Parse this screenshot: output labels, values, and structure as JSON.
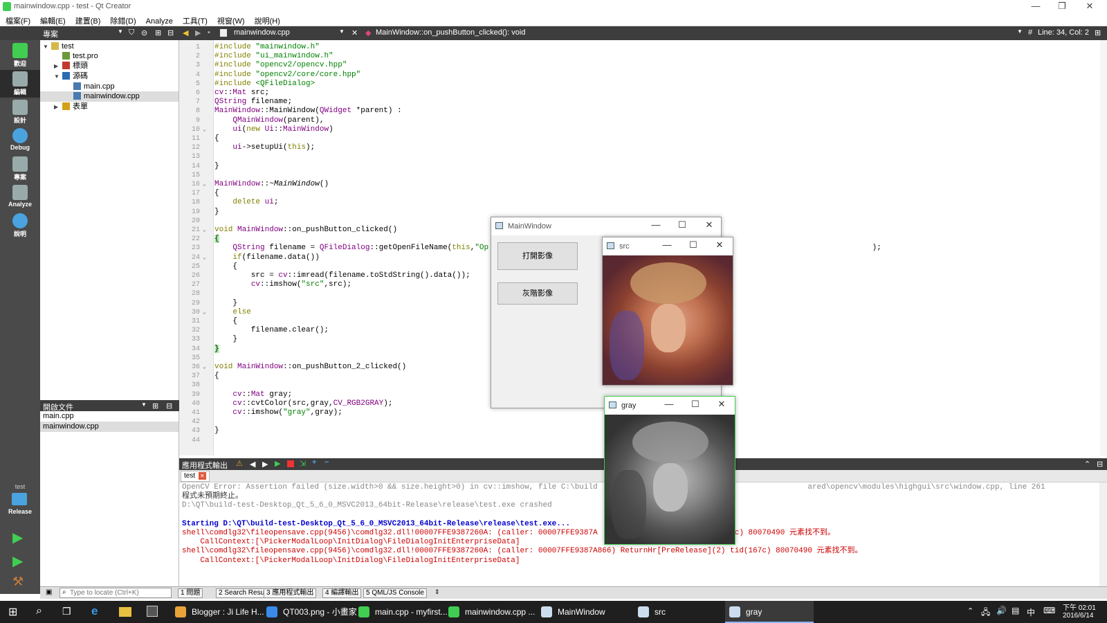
{
  "window": {
    "title": "mainwindow.cpp - test - Qt Creator"
  },
  "menu": [
    "檔案(F)",
    "編輯(E)",
    "建置(B)",
    "除錯(D)",
    "Analyze",
    "工具(T)",
    "視窗(W)",
    "說明(H)"
  ],
  "toolbar": {
    "project_label": "專案",
    "file_name": "mainwindow.cpp",
    "function_name": "MainWindow::on_pushButton_clicked(): void",
    "cursor_pos": "Line: 34, Col: 2"
  },
  "modes": [
    {
      "label": "歡迎",
      "icon": "qt-logo-icon"
    },
    {
      "label": "編輯",
      "icon": "edit-icon"
    },
    {
      "label": "設計",
      "icon": "design-icon"
    },
    {
      "label": "Debug",
      "icon": "debug-icon"
    },
    {
      "label": "專案",
      "icon": "projects-icon"
    },
    {
      "label": "Analyze",
      "icon": "analyze-icon"
    },
    {
      "label": "說明",
      "icon": "help-icon"
    }
  ],
  "kit": {
    "project": "test",
    "config": "Release"
  },
  "project_tree": [
    {
      "label": "test",
      "level": 0,
      "arrow": "▼",
      "icon_color": "#d4b84a"
    },
    {
      "label": "test.pro",
      "level": 1,
      "arrow": "",
      "icon_color": "#6a9a3a"
    },
    {
      "label": "標頭",
      "level": 1,
      "arrow": "▶",
      "icon_color": "#c0392b"
    },
    {
      "label": "源碼",
      "level": 1,
      "arrow": "▼",
      "icon_color": "#2b6cb0"
    },
    {
      "label": "main.cpp",
      "level": 2,
      "arrow": "",
      "icon_color": "#4a7ab0"
    },
    {
      "label": "mainwindow.cpp",
      "level": 2,
      "arrow": "",
      "icon_color": "#4a7ab0",
      "selected": true
    },
    {
      "label": "表單",
      "level": 1,
      "arrow": "▶",
      "icon_color": "#d4a017"
    }
  ],
  "open_docs": {
    "title": "開啟文件",
    "items": [
      {
        "label": "main.cpp"
      },
      {
        "label": "mainwindow.cpp",
        "selected": true
      }
    ]
  },
  "code_lines": [
    {
      "n": "1",
      "fold": "",
      "html": "<span class='kw'>#include</span> <span class='str'>\"mainwindow.h\"</span>"
    },
    {
      "n": "2",
      "fold": "",
      "html": "<span class='kw'>#include</span> <span class='str'>\"ui_mainwindow.h\"</span>"
    },
    {
      "n": "3",
      "fold": "",
      "html": "<span class='kw'>#include</span> <span class='str'>\"opencv2/opencv.hpp\"</span>"
    },
    {
      "n": "4",
      "fold": "",
      "html": "<span class='kw'>#include</span> <span class='str'>\"opencv2/core/core.hpp\"</span>"
    },
    {
      "n": "5",
      "fold": "",
      "html": "<span class='kw'>#include</span> <span class='str'>&lt;QFileDialog&gt;</span>"
    },
    {
      "n": "6",
      "fold": "",
      "html": "<span class='typ'>cv</span>::<span class='typ'>Mat</span> src;"
    },
    {
      "n": "7",
      "fold": "",
      "html": "<span class='typ'>QString</span> filename;"
    },
    {
      "n": "8",
      "fold": "",
      "html": "<span class='typ'>MainWindow</span>::MainWindow(<span class='typ'>QWidget</span> *parent) :"
    },
    {
      "n": "9",
      "fold": "",
      "html": "    <span class='typ'>QMainWindow</span>(parent),"
    },
    {
      "n": "10",
      "fold": "⌄",
      "html": "    <span class='typ'>ui</span>(<span class='kw'>new</span> <span class='typ'>Ui</span>::<span class='typ'>MainWindow</span>)"
    },
    {
      "n": "11",
      "fold": "",
      "html": "{"
    },
    {
      "n": "12",
      "fold": "",
      "html": "    <span class='typ'>ui</span>-&gt;setupUi(<span class='kw'>this</span>);"
    },
    {
      "n": "13",
      "fold": "",
      "html": ""
    },
    {
      "n": "14",
      "fold": "",
      "html": "}"
    },
    {
      "n": "15",
      "fold": "",
      "html": ""
    },
    {
      "n": "16",
      "fold": "⌄",
      "html": "<span class='typ'>MainWindow</span>::~<i>MainWindow</i>()"
    },
    {
      "n": "17",
      "fold": "",
      "html": "{"
    },
    {
      "n": "18",
      "fold": "",
      "html": "    <span class='kw'>delete</span> <span class='typ'>ui</span>;"
    },
    {
      "n": "19",
      "fold": "",
      "html": "}"
    },
    {
      "n": "20",
      "fold": "",
      "html": ""
    },
    {
      "n": "21",
      "fold": "⌄",
      "html": "<span class='kw'>void</span> <span class='typ'>MainWindow</span>::on_pushButton_clicked()"
    },
    {
      "n": "22",
      "fold": "",
      "html": "<span style='background:#b4eeb4'>{</span>"
    },
    {
      "n": "23",
      "fold": "",
      "html": "    <span class='typ'>QString</span> filename = <span class='typ'>QFileDialog</span>::getOpenFileName(<span class='kw'>this</span>,<span class='str'>\"Op</span>                                                                                    );"
    },
    {
      "n": "24",
      "fold": "⌄",
      "html": "    <span class='kw'>if</span>(filename.data())"
    },
    {
      "n": "25",
      "fold": "",
      "html": "    {"
    },
    {
      "n": "26",
      "fold": "",
      "html": "        src = <span class='typ'>cv</span>::imread(filename.toStdString().data());"
    },
    {
      "n": "27",
      "fold": "",
      "html": "        <span class='typ'>cv</span>::imshow(<span class='str'>\"src\"</span>,src);"
    },
    {
      "n": "28",
      "fold": "",
      "html": ""
    },
    {
      "n": "29",
      "fold": "",
      "html": "    }"
    },
    {
      "n": "30",
      "fold": "⌄",
      "html": "    <span class='kw'>else</span>"
    },
    {
      "n": "31",
      "fold": "",
      "html": "    {"
    },
    {
      "n": "32",
      "fold": "",
      "html": "        filename.clear();"
    },
    {
      "n": "33",
      "fold": "",
      "html": "    }"
    },
    {
      "n": "34",
      "fold": "",
      "html": "<span style='background:#b4eeb4'>}</span>"
    },
    {
      "n": "35",
      "fold": "",
      "html": ""
    },
    {
      "n": "36",
      "fold": "⌄",
      "html": "<span class='kw'>void</span> <span class='typ'>MainWindow</span>::on_pushButton_2_clicked()"
    },
    {
      "n": "37",
      "fold": "",
      "html": "{"
    },
    {
      "n": "38",
      "fold": "",
      "html": ""
    },
    {
      "n": "39",
      "fold": "",
      "html": "    <span class='typ'>cv</span>::<span class='typ'>Mat</span> gray;"
    },
    {
      "n": "40",
      "fold": "",
      "html": "    <span class='typ'>cv</span>::cvtColor(src,gray,<span class='typ'>CV_RGB2GRAY</span>);"
    },
    {
      "n": "41",
      "fold": "",
      "html": "    <span class='typ'>cv</span>::imshow(<span class='str'>\"gray\"</span>,gray);"
    },
    {
      "n": "42",
      "fold": "",
      "html": ""
    },
    {
      "n": "43",
      "fold": "",
      "html": "}"
    },
    {
      "n": "44",
      "fold": "",
      "html": ""
    }
  ],
  "output_panel": {
    "title": "應用程式輸出",
    "tab": "test"
  },
  "output_lines": [
    {
      "cls": "gray",
      "text": "OpenCV Error: Assertion failed (size.width>0 && size.height>0) in cv::imshow, file C:\\build                                              ared\\opencv\\modules\\highgui\\src\\window.cpp, line 261"
    },
    {
      "cls": "black",
      "text": "程式未預期終止。"
    },
    {
      "cls": "gray",
      "text": "D:\\QT\\build-test-Desktop_Qt_5_6_0_MSVC2013_64bit-Release\\release\\test.exe crashed"
    },
    {
      "cls": "gray",
      "text": ""
    },
    {
      "cls": "blue",
      "text": "Starting D:\\QT\\build-test-Desktop_Qt_5_6_0_MSVC2013_64bit-Release\\release\\test.exe..."
    },
    {
      "cls": "red",
      "text": "shell\\comdlg32\\fileopensave.cpp(9456)\\comdlg32.dll!00007FFE9387260A: (caller: 00007FFE9387A                       tid(167c) 80070490 元素找不到。"
    },
    {
      "cls": "red",
      "text": "    CallContext:[\\PickerModalLoop\\InitDialog\\FileDialogInitEnterpriseData]"
    },
    {
      "cls": "red",
      "text": "shell\\comdlg32\\fileopensave.cpp(9456)\\comdlg32.dll!00007FFE9387260A: (caller: 00007FFE9387A866) ReturnHr[PreRelease](2) tid(167c) 80070490 元素找不到。"
    },
    {
      "cls": "red",
      "text": "    CallContext:[\\PickerModalLoop\\InitDialog\\FileDialogInitEnterpriseData]"
    }
  ],
  "statusbar": {
    "locate_placeholder": "Type to locate (Ctrl+K)",
    "tabs": [
      "1 問題",
      "2 Search Results",
      "3 應用程式輸出",
      "4 編譯輸出",
      "5 QML/JS Console"
    ]
  },
  "mainwindow_dialog": {
    "title": "MainWindow",
    "open_button": "打開影像",
    "gray_button": "灰階影像"
  },
  "src_window": {
    "title": "src"
  },
  "gray_window": {
    "title": "gray"
  },
  "taskbar": {
    "tasks": [
      {
        "label": "Blogger : Ji Life H...",
        "color": "#e8a33a"
      },
      {
        "label": "QT003.png - 小畫家",
        "color": "#3a8ae8"
      },
      {
        "label": "main.cpp - myfirst...",
        "color": "#41cd52"
      },
      {
        "label": "mainwindow.cpp ...",
        "color": "#41cd52"
      },
      {
        "label": "MainWindow",
        "color": "#cde"
      },
      {
        "label": "src",
        "color": "#cde"
      },
      {
        "label": "gray",
        "color": "#cde",
        "active": true
      }
    ],
    "time": "下午 02:01",
    "date": "2016/6/14",
    "ime": "中"
  }
}
